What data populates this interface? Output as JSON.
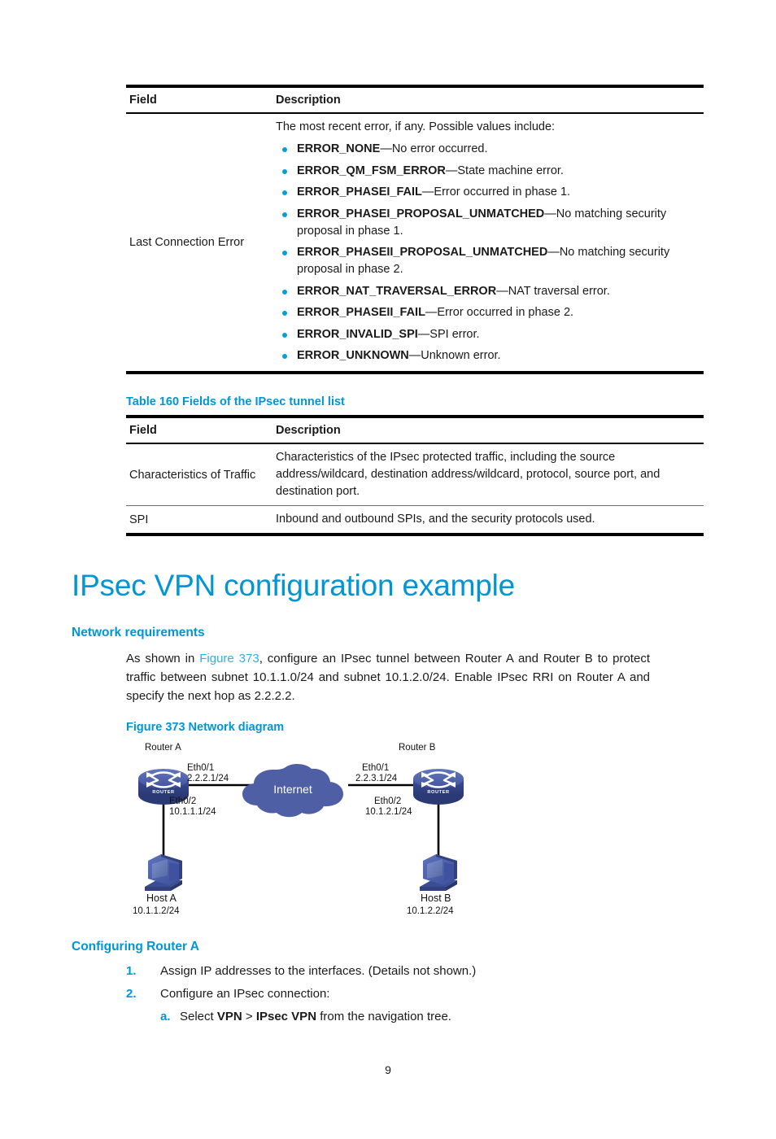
{
  "table1": {
    "headers": [
      "Field",
      "Description"
    ],
    "row": {
      "field": "Last Connection Error",
      "intro": "The most recent error, if any. Possible values include:",
      "bullets": [
        {
          "code": "ERROR_NONE",
          "desc": "—No error occurred."
        },
        {
          "code": "ERROR_QM_FSM_ERROR",
          "desc": "—State machine error."
        },
        {
          "code": "ERROR_PHASEI_FAIL",
          "desc": "—Error occurred in phase 1."
        },
        {
          "code": "ERROR_PHASEI_PROPOSAL_UNMATCHED",
          "desc": "—No matching security proposal in phase 1."
        },
        {
          "code": "ERROR_PHASEII_PROPOSAL_UNMATCHED",
          "desc": "—No matching security proposal in phase 2."
        },
        {
          "code": "ERROR_NAT_TRAVERSAL_ERROR",
          "desc": "—NAT traversal error."
        },
        {
          "code": "ERROR_PHASEII_FAIL",
          "desc": "—Error occurred in phase 2."
        },
        {
          "code": "ERROR_INVALID_SPI",
          "desc": "—SPI error."
        },
        {
          "code": "ERROR_UNKNOWN",
          "desc": "—Unknown error."
        }
      ]
    }
  },
  "table2": {
    "caption": "Table 160 Fields of the IPsec tunnel list",
    "headers": [
      "Field",
      "Description"
    ],
    "rows": [
      {
        "field": "Characteristics of Traffic",
        "desc": "Characteristics of the IPsec protected traffic, including the source address/wildcard, destination address/wildcard, protocol, source port, and destination port."
      },
      {
        "field": "SPI",
        "desc": "Inbound and outbound SPIs, and the security protocols used."
      }
    ]
  },
  "chapter_title": "IPsec VPN configuration example",
  "sections": {
    "network_requirements": {
      "heading": "Network requirements",
      "para_a": "As shown in ",
      "para_xref": "Figure 373",
      "para_b": ", configure an IPsec tunnel between Router A and Router B to protect traffic between subnet 10.1.1.0/24 and subnet 10.1.2.0/24. Enable IPsec RRI on Router A and specify the next hop as 2.2.2.2.",
      "figure_caption": "Figure 373 Network diagram"
    },
    "configuring_router_a": {
      "heading": "Configuring Router A",
      "steps": [
        {
          "num": "1.",
          "text": "Assign IP addresses to the interfaces. (Details not shown.)"
        },
        {
          "num": "2.",
          "text": "Configure an IPsec connection:"
        }
      ],
      "substeps": [
        {
          "num": "a.",
          "prefix": "Select ",
          "bold1": "VPN",
          "sep": " > ",
          "bold2": "IPsec VPN",
          "suffix": " from the navigation tree."
        }
      ]
    }
  },
  "diagram": {
    "router_a_label": "Router A",
    "router_b_label": "Router B",
    "router_glyph_text": "ROUTER",
    "cloud_label": "Internet",
    "a_eth01_if": "Eth0/1",
    "a_eth01_ip": "2.2.2.1/24",
    "a_eth02_if": "Eth0/2",
    "a_eth02_ip": "10.1.1.1/24",
    "b_eth01_if": "Eth0/1",
    "b_eth01_ip": "2.2.3.1/24",
    "b_eth02_if": "Eth0/2",
    "b_eth02_ip": "10.1.2.1/24",
    "host_a_label": "Host A",
    "host_a_ip": "10.1.1.2/24",
    "host_b_label": "Host B",
    "host_b_ip": "10.1.2.2/24",
    "colors": {
      "router_body": "#3a4c94",
      "router_top": "#4d62ad",
      "cloud": "#4f5fa5",
      "host_dark": "#3a4c94",
      "host_mid": "#4d62ad",
      "host_light": "#6b7fc4",
      "link": "#000000"
    }
  },
  "footer": {
    "page_number": "9"
  },
  "theme": {
    "accent_blue": "#0096d6",
    "bullet_blue": "#00a0df",
    "xref_blue": "#33aee4",
    "text": "#1a1a1a"
  }
}
